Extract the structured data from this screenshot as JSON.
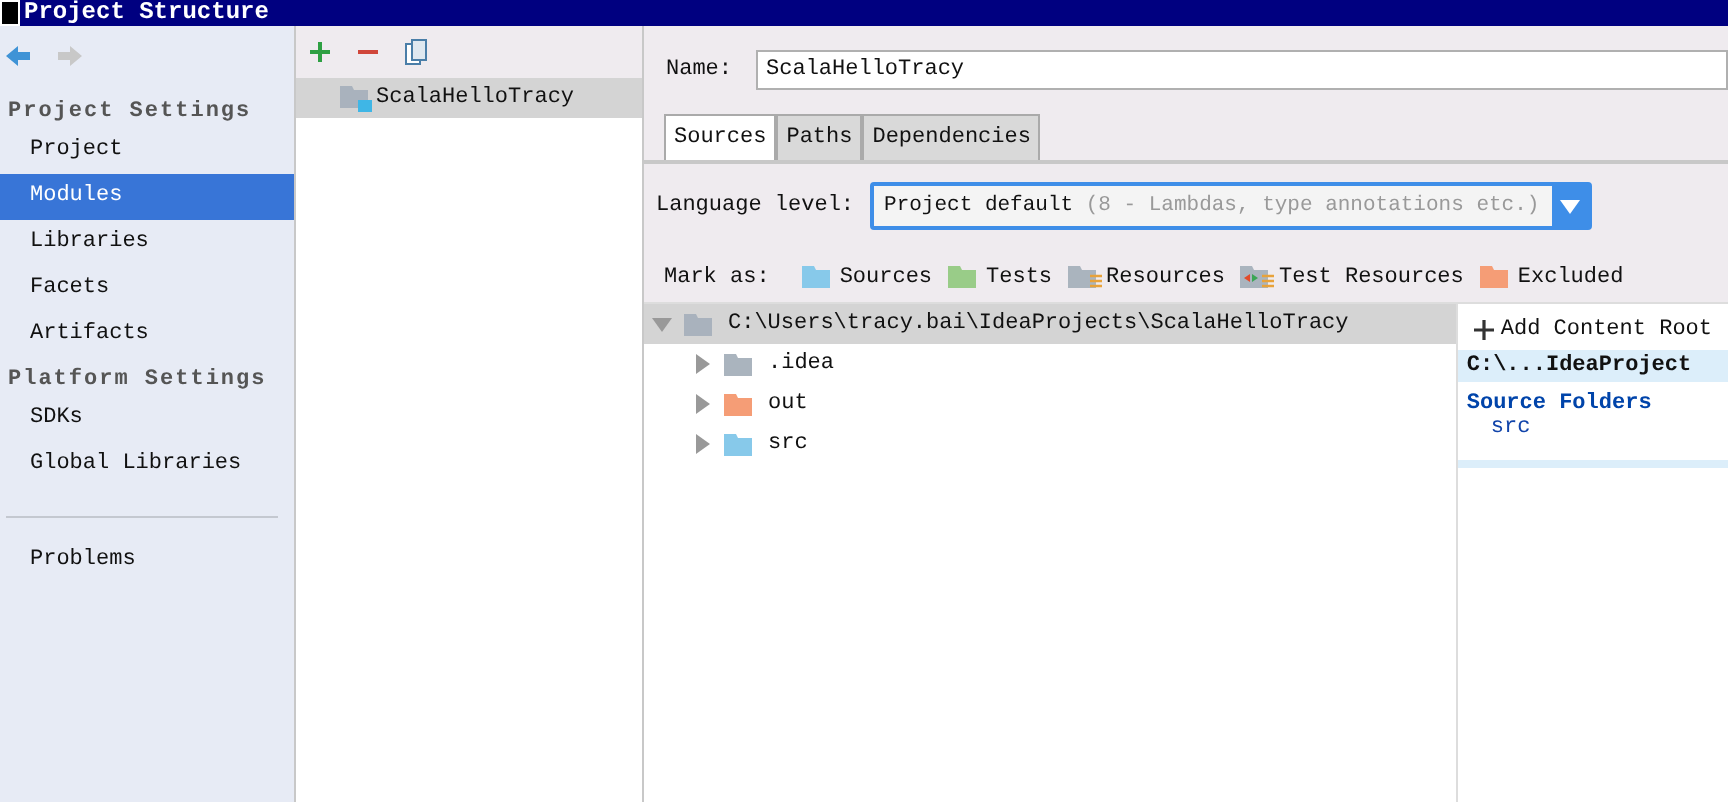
{
  "window": {
    "title": "Project Structure"
  },
  "sidebar": {
    "sections": [
      {
        "title": "Project Settings",
        "items": [
          {
            "label": "Project",
            "selected": false
          },
          {
            "label": "Modules",
            "selected": true
          },
          {
            "label": "Libraries",
            "selected": false
          },
          {
            "label": "Facets",
            "selected": false
          },
          {
            "label": "Artifacts",
            "selected": false
          }
        ]
      },
      {
        "title": "Platform Settings",
        "items": [
          {
            "label": "SDKs",
            "selected": false
          },
          {
            "label": "Global Libraries",
            "selected": false
          }
        ]
      }
    ],
    "bottom_items": [
      {
        "label": "Problems",
        "selected": false
      }
    ]
  },
  "modules": [
    {
      "name": "ScalaHelloTracy",
      "selected": true
    }
  ],
  "name_field": {
    "label": "Name:",
    "value": "ScalaHelloTracy"
  },
  "tabs": [
    {
      "label": "Sources",
      "selected": true
    },
    {
      "label": "Paths",
      "selected": false
    },
    {
      "label": "Dependencies",
      "selected": false
    }
  ],
  "language_level": {
    "label": "Language level:",
    "value": "Project default",
    "hint": "(8 - Lambdas, type annotations etc.)"
  },
  "mark_as": {
    "label": "Mark as:",
    "options": [
      {
        "label": "Sources",
        "kind": "plain",
        "color": "#87c9ea"
      },
      {
        "label": "Tests",
        "kind": "plain",
        "color": "#99cc88"
      },
      {
        "label": "Resources",
        "kind": "resource",
        "color": "#aab4be"
      },
      {
        "label": "Test Resources",
        "kind": "test_resource",
        "color": "#aab4be"
      },
      {
        "label": "Excluded",
        "kind": "plain",
        "color": "#f59d76"
      }
    ]
  },
  "tree": {
    "label": "C:\\Users\\tracy.bai\\IdeaProjects\\ScalaHelloTracy",
    "expanded": true,
    "children": [
      {
        "label": ".idea",
        "color": "#aab4be",
        "expanded": false
      },
      {
        "label": "out",
        "color": "#f59d76",
        "expanded": false
      },
      {
        "label": "src",
        "color": "#87c9ea",
        "expanded": false
      }
    ]
  },
  "content_root": {
    "add_button": "Add Content Root",
    "root_label": "C:\\...IdeaProject",
    "section_title": "Source Folders",
    "folders": [
      "src"
    ]
  }
}
